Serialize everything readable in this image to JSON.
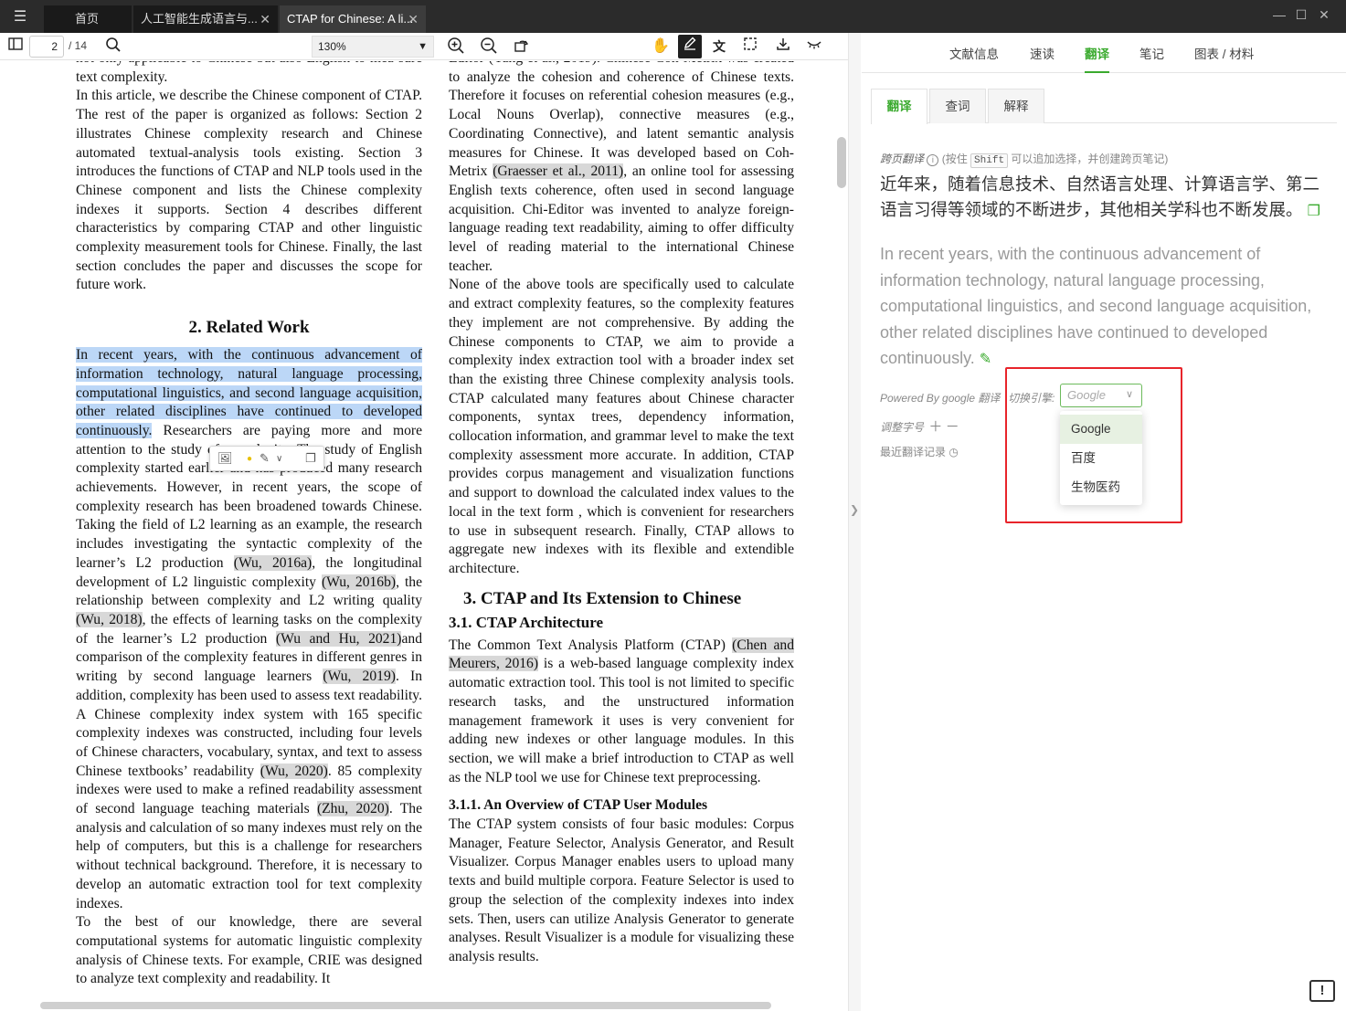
{
  "titlebar": {
    "tabs": [
      {
        "label": "首页"
      },
      {
        "label": "人工智能生成语言与..."
      },
      {
        "label": "CTAP for Chinese: A li..."
      }
    ]
  },
  "toolbar": {
    "current_page": "2",
    "total_pages": "/ 14",
    "zoom": "130%"
  },
  "pdf": {
    "left_column": {
      "p0": "not only applicable to Chinese but also English to mea-sure text complexity.",
      "p1": "In this article, we describe the Chinese component of CTAP. The rest of the paper is organized as follows: Section 2 illustrates Chinese complexity research and Chinese automated textual-analysis tools existing. Section 3 introduces the functions of CTAP and NLP tools used in the Chinese component and lists the Chinese complexity indexes it supports. Section 4 describes different characteristics by comparing CTAP and other linguistic complexity measurement tools for Chinese. Finally, the last section concludes the paper and discusses the scope for future work.",
      "section2": "2.   Related Work",
      "highlighted": "In recent years, with the continuous advancement of information technology, natural language processing, computational linguistics, and second language acquisition, other related disciplines have continued to developed continuously.",
      "p2a": " Researchers are paying more and more attention to the study of complexity. The study of English complexity started earlier and has produced many research achievements. However, in recent years, the scope of complexity research has been broadened towards Chinese. Taking the field of L2 learning as an example, the research includes investigating the syntactic complexity of the learner’s L2 production ",
      "c1": "(Wu, 2016a)",
      "p2b": ", the longitudinal development of L2 linguistic complexity ",
      "c2": "(Wu, 2016b)",
      "p2c": ", the relationship between complexity and L2 writing quality ",
      "c3": "(Wu, 2018)",
      "p2d": ", the effects of learning tasks on the complexity of the learner’s L2 production ",
      "c4": "(Wu and Hu, 2021)",
      "p2e": "and comparison of the complexity features in different genres in writing by second language learners ",
      "c5": "(Wu, 2019)",
      "p2f": ". In addition, complexity has been used to assess text readability. A Chinese complexity index system with 165 specific complexity indexes was constructed, including four levels of Chinese characters, vocabulary, syntax, and text to assess Chinese textbooks’ readability ",
      "c6": "(Wu, 2020)",
      "p2g": ". 85 complexity indexes were used to make a refined readability assessment of second language teaching materials ",
      "c7": "(Zhu, 2020)",
      "p2h": ". The analysis and calculation of so many indexes must rely on the help of computers, but this is a challenge for researchers without technical background. Therefore, it is necessary to develop an automatic extraction tool for text complexity indexes.",
      "p3": "To the best of our knowledge, there are several computational systems for automatic linguistic complexity analysis of Chinese texts. For example, CRIE was designed to analyze text complexity and readability. It"
    },
    "right_column": {
      "p0a": "Editor (Yang et al., 2019). Chinese Coh-Metrix was created to analyze the cohesion and coherence of Chinese texts. Therefore it focuses on referential cohesion measures (e.g., Local Nouns Overlap), connective measures (e.g., Coordinating Connective), and latent semantic analysis measures for Chinese. It was developed based on Coh-Metrix ",
      "c1": "(Graesser et al., 2011)",
      "p0b": ", an online tool for assessing English texts coherence, often used in second language acquisition. Chi-Editor was invented to analyze foreign-language reading text readability, aiming to offer difficulty level of reading material to the international Chinese teacher.",
      "p1": "None of the above tools are specifically used to calculate and extract complexity features, so the complexity features they implement are not comprehensive. By adding the Chinese components to CTAP, we aim to provide a complexity index extraction tool with a broader index set than the existing three Chinese complexity analysis tools. CTAP calculated many features about Chinese character components, syntax trees, dependency information, collocation information, and grammar level to make the text complexity assessment more accurate. In addition, CTAP provides corpus management and visualization functions and support to download the calculated index values to the local in the text form , which is convenient for researchers to use in subsequent research. Finally, CTAP allows to aggregate new indexes with its flexible and extendible architecture.",
      "section3": "3.   CTAP and Its Extension to Chinese",
      "sub31": "3.1.   CTAP Architecture",
      "p2a": "The Common Text Analysis Platform (CTAP) ",
      "c2": "(Chen and Meurers, 2016)",
      "p2b": " is a web-based language complexity index automatic extraction tool. This tool is not limited to specific research tasks, and the unstructured information management framework it uses is very convenient for adding new indexes or other language modules. In this section, we will make a brief introduction to CTAP as well as the NLP tool we use for Chinese text preprocessing.",
      "sub311": "3.1.1.   An Overview of CTAP User Modules",
      "p3": "The CTAP system consists of four basic modules: Corpus Manager, Feature Selector, Analysis Generator, and Result Visualizer. Corpus Manager enables users to upload many texts and build multiple corpora. Feature Selector is used to group the selection of the complexity indexes into index sets. Then, users can utilize Analysis Generator to generate analyses. Result Visualizer is a module for visualizing these analysis results."
    }
  },
  "panel": {
    "nav": [
      "文献信息",
      "速读",
      "翻译",
      "笔记",
      "图表 / 材料"
    ],
    "sub_tabs": [
      "翻译",
      "查词",
      "解释"
    ],
    "cross_page": {
      "title": "跨页翻译",
      "hint_pre": "(按住",
      "key": "Shift",
      "hint_post": "可以追加选择，并创建跨页笔记)"
    },
    "translation_zh": "近年来，随着信息技术、自然语言处理、计算语言学、第二语言习得等领域的不断进步，其他相关学科也不断发展。",
    "source_en": "In recent years, with the continuous advancement of information technology, natural language processing, computational linguistics, and second language acquisition, other related disciplines have continued to developed continuously.",
    "powered_by": "Powered By google 翻译",
    "engine_label": "切换引擎:",
    "engine_selected": "Google",
    "engine_options": [
      "Google",
      "百度",
      "生物医药"
    ],
    "font_size_label": "调整字号",
    "recent_label": "最近翻译记录"
  },
  "colors": {
    "accent": "#3aaa2e",
    "highlight": "#bcd7f7",
    "annotation_box": "#e8242b"
  }
}
